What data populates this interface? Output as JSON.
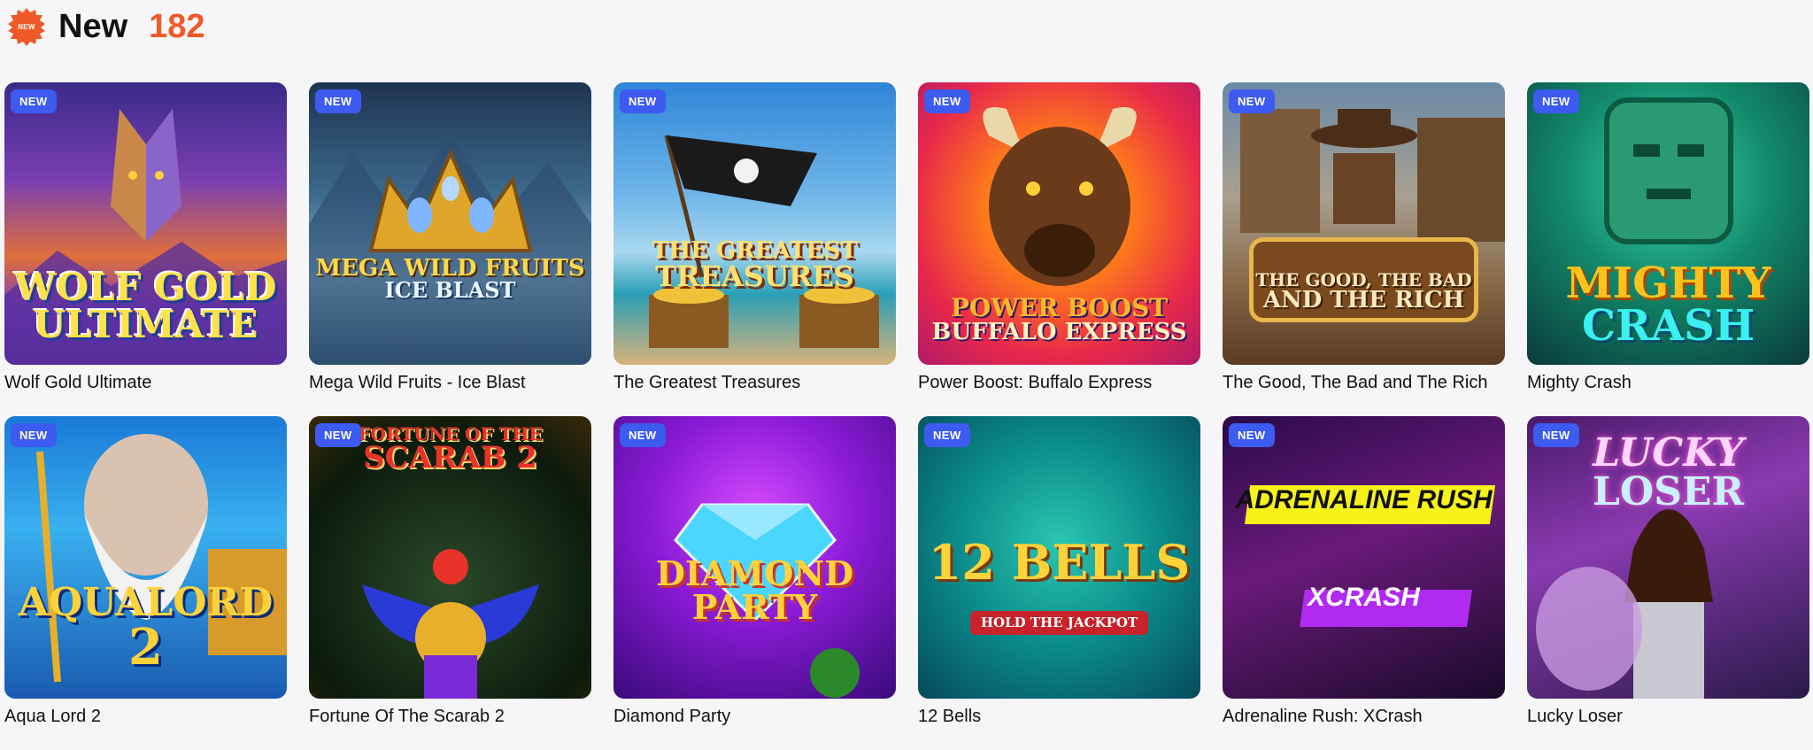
{
  "header": {
    "icon": "new-starburst-icon",
    "icon_text": "NEW",
    "title": "New",
    "count": "182",
    "accent_color": "#f05a28"
  },
  "tag_label": "NEW",
  "games": [
    {
      "title": "Wolf Gold Ultimate",
      "art_l1": "Wolf Gold",
      "art_l2": "Ultimate"
    },
    {
      "title": "Mega Wild Fruits - Ice Blast",
      "art_l1": "Mega Wild Fruits",
      "art_l2": "Ice Blast"
    },
    {
      "title": "The Greatest Treasures",
      "art_l1": "The Greatest",
      "art_l2": "Treasures"
    },
    {
      "title": "Power Boost: Buffalo Express",
      "art_l1": "Power Boost",
      "art_l2": "Buffalo Express"
    },
    {
      "title": "The Good, The Bad and The Rich",
      "art_l1": "The Good, The Bad",
      "art_l2": "and The Rich"
    },
    {
      "title": "Mighty Crash",
      "art_l1": "Mighty",
      "art_l2": "Crash"
    },
    {
      "title": "Aqua Lord 2",
      "art_l1": "Aqualord",
      "art_l2": "2"
    },
    {
      "title": "Fortune Of The Scarab 2",
      "art_l1": "Fortune of the",
      "art_l2": "Scarab 2"
    },
    {
      "title": "Diamond Party",
      "art_l1": "Diamond Party",
      "art_l2": ""
    },
    {
      "title": "12 Bells",
      "art_l1": "12 Bells",
      "art_l2": "Hold the Jackpot"
    },
    {
      "title": "Adrenaline Rush: XCrash",
      "art_l1": "Adrenaline Rush",
      "art_l2": "XCrash"
    },
    {
      "title": "Lucky Loser",
      "art_l1": "Lucky",
      "art_l2": "Loser"
    }
  ]
}
